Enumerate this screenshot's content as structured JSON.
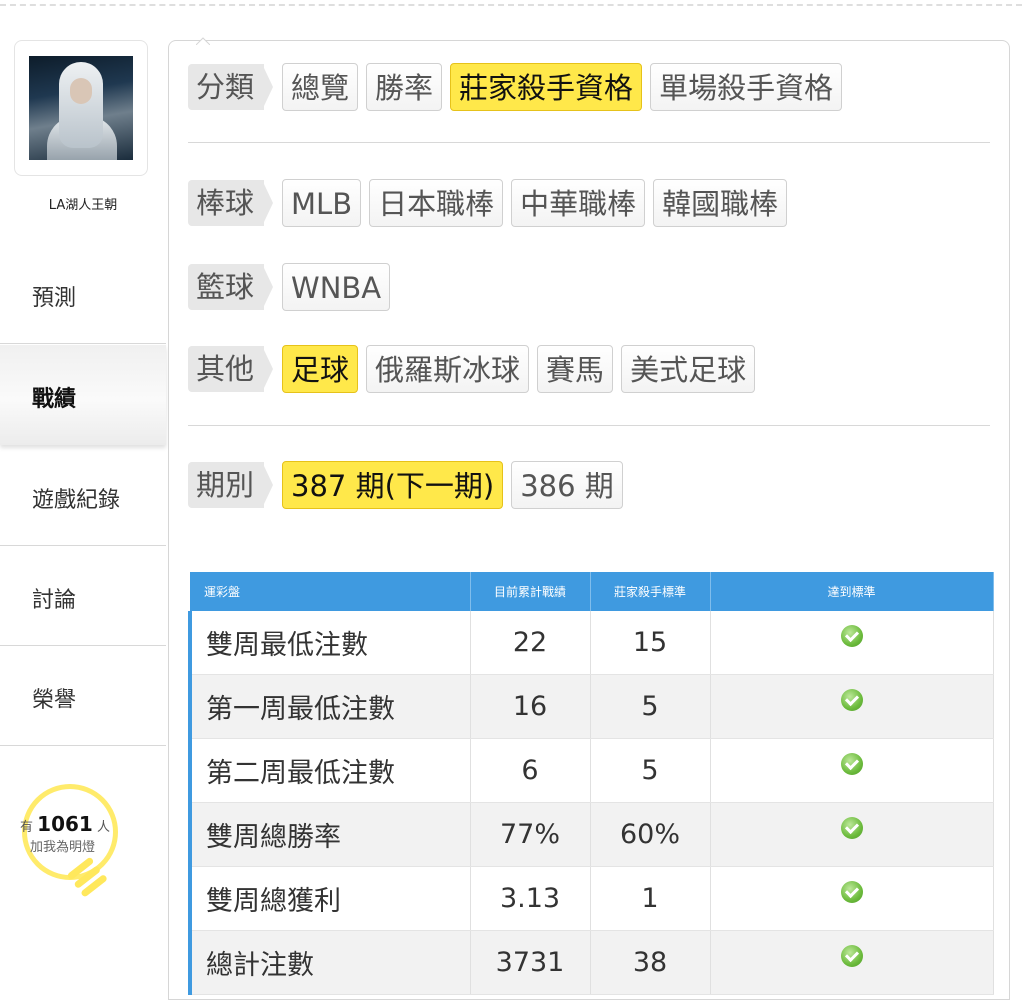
{
  "user": {
    "name": "LA湖人王朝"
  },
  "sidebar": {
    "items": [
      {
        "label": "預測"
      },
      {
        "label": "戰績"
      },
      {
        "label": "遊戲紀錄"
      },
      {
        "label": "討論"
      },
      {
        "label": "榮譽"
      }
    ],
    "active_item": "戰績"
  },
  "lamp": {
    "prefix": "有",
    "count": "1061",
    "suffix": "人",
    "caption": "加我為明燈"
  },
  "filters": {
    "category": {
      "label": "分類",
      "options": [
        "總覽",
        "勝率",
        "莊家殺手資格",
        "單場殺手資格"
      ],
      "active": "莊家殺手資格"
    },
    "baseball": {
      "label": "棒球",
      "options": [
        "MLB",
        "日本職棒",
        "中華職棒",
        "韓國職棒"
      ]
    },
    "basketball": {
      "label": "籃球",
      "options": [
        "WNBA"
      ]
    },
    "other": {
      "label": "其他",
      "options": [
        "足球",
        "俄羅斯冰球",
        "賽馬",
        "美式足球"
      ],
      "active": "足球"
    },
    "period": {
      "label": "期別",
      "options": [
        "387 期(下一期)",
        "386 期"
      ],
      "active": "387 期(下一期)"
    }
  },
  "table": {
    "headers": [
      "運彩盤",
      "目前累計戰績",
      "莊家殺手標準",
      "達到標準"
    ],
    "rows": [
      {
        "name": "雙周最低注數",
        "current": "22",
        "standard": "15",
        "met": true
      },
      {
        "name": "第一周最低注數",
        "current": "16",
        "standard": "5",
        "met": true
      },
      {
        "name": "第二周最低注數",
        "current": "6",
        "standard": "5",
        "met": true
      },
      {
        "name": "雙周總勝率",
        "current": "77%",
        "standard": "60%",
        "met": true
      },
      {
        "name": "雙周總獲利",
        "current": "3.13",
        "standard": "1",
        "met": true
      },
      {
        "name": "總計注數",
        "current": "3731",
        "standard": "38",
        "met": true
      }
    ]
  },
  "colors": {
    "accent_blue": "#3f9ae0",
    "active_yellow": "#ffe84a",
    "check_green": "#6cbb3c",
    "lamp_yellow": "#ffeb6b"
  }
}
